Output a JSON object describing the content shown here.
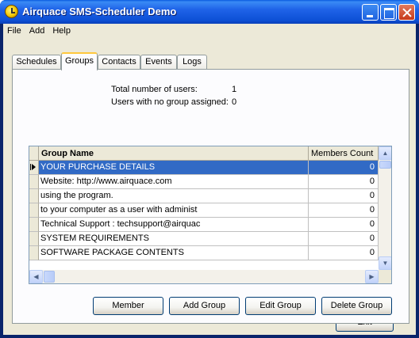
{
  "window": {
    "title": "Airquace SMS-Scheduler Demo"
  },
  "menu": [
    "File",
    "Add",
    "Help"
  ],
  "tabs": [
    {
      "label": "Schedules",
      "active": false
    },
    {
      "label": "Groups",
      "active": true
    },
    {
      "label": "Contacts",
      "active": false
    },
    {
      "label": "Events",
      "active": false
    },
    {
      "label": "Logs",
      "active": false
    }
  ],
  "stats": {
    "total_users_label": "Total number of users:",
    "total_users_value": "1",
    "no_group_label": "Users with no group assigned:",
    "no_group_value": "0"
  },
  "grid": {
    "columns": [
      "Group Name",
      "Members Count"
    ],
    "selected_row": 0,
    "rows": [
      {
        "name": "YOUR PURCHASE DETAILS",
        "count": "0"
      },
      {
        "name": "Website: http://www.airquace.com",
        "count": "0"
      },
      {
        "name": "using the program.",
        "count": "0"
      },
      {
        "name": "to your computer as a user with administ",
        "count": "0"
      },
      {
        "name": "Technical Support :  techsupport@airquac",
        "count": "0"
      },
      {
        "name": "SYSTEM REQUIREMENTS",
        "count": "0"
      },
      {
        "name": "SOFTWARE PACKAGE CONTENTS",
        "count": "0"
      }
    ]
  },
  "buttons": {
    "member": "Member",
    "add_group": "Add Group",
    "edit_group": "Edit Group",
    "delete_group": "Delete Group",
    "exit": "Exit"
  },
  "colors": {
    "titlebar": "#0A5BE0",
    "selection": "#316AC5",
    "dialog_face": "#ECE9D8",
    "tab_highlight": "#FFC83C"
  },
  "icons": [
    "app-clock-icon",
    "minimize-icon",
    "maximize-icon",
    "close-icon",
    "row-pointer-icon",
    "scroll-up-icon",
    "scroll-down-icon",
    "scroll-left-icon",
    "scroll-right-icon"
  ]
}
